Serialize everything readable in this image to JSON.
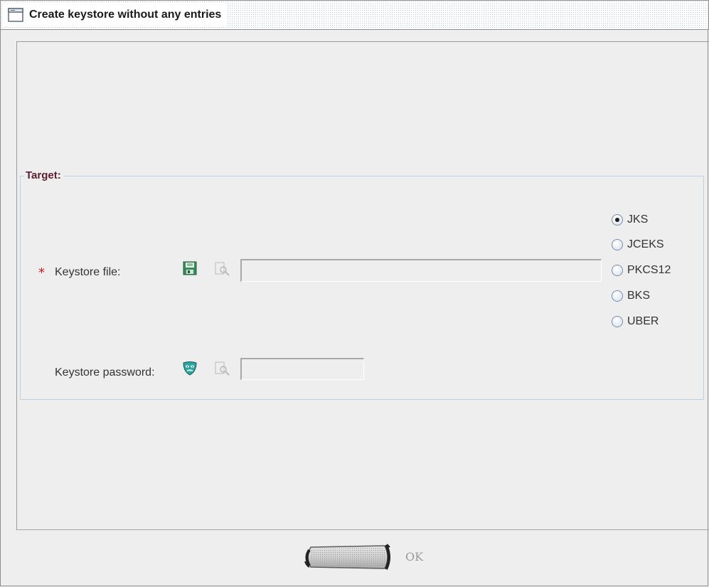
{
  "window": {
    "title": "Create keystore without any entries"
  },
  "target": {
    "group_title": "Target:",
    "keystore_file": {
      "required_marker": "*",
      "label": "Keystore file:",
      "value": "",
      "icons": [
        "save-icon",
        "browse-icon"
      ]
    },
    "keystore_password": {
      "label": "Keystore password:",
      "value": "",
      "icons": [
        "mask-icon",
        "browse-icon"
      ]
    },
    "keystore_types": [
      {
        "label": "JKS",
        "selected": true
      },
      {
        "label": "JCEKS",
        "selected": false
      },
      {
        "label": "PKCS12",
        "selected": false
      },
      {
        "label": "BKS",
        "selected": false
      },
      {
        "label": "UBER",
        "selected": false
      }
    ]
  },
  "buttons": {
    "ok_label": "OK"
  },
  "colors": {
    "required": "#d11a1a",
    "group_title": "#5a2030",
    "group_border": "#bcd0e5"
  }
}
